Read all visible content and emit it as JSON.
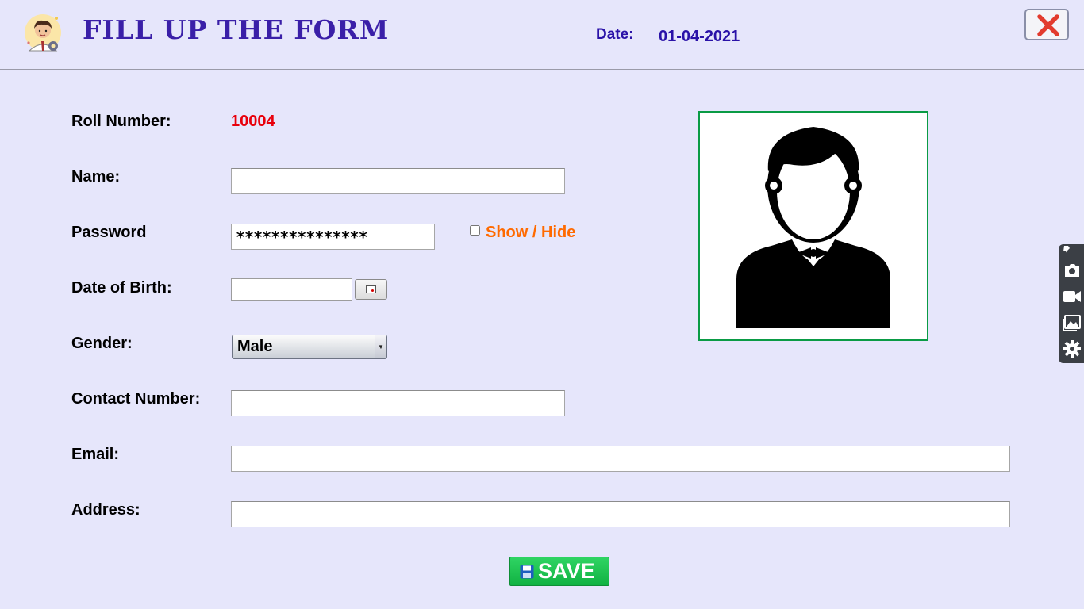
{
  "header": {
    "title": "FILL UP THE FORM",
    "date_label": "Date:",
    "date_value": "01-04-2021"
  },
  "form": {
    "roll_label": "Roll Number:",
    "roll_value": "10004",
    "name_label": "Name:",
    "name_value": "",
    "password_label": "Password",
    "password_value": "***************",
    "show_hide_label": "Show / Hide",
    "show_hide_checked": false,
    "dob_label": "Date of Birth:",
    "dob_value": "",
    "gender_label": "Gender:",
    "gender_value": "Male",
    "contact_label": "Contact Number:",
    "contact_value": "",
    "email_label": "Email:",
    "email_value": "",
    "address_label": "Address:",
    "address_value": ""
  },
  "actions": {
    "save_label": "SAVE"
  },
  "icons": {
    "logo": "user-settings-icon",
    "close": "close-icon",
    "calendar": "calendar-icon",
    "avatar": "user-avatar-icon",
    "save": "floppy-disk-icon",
    "toolbar": [
      "pin-icon",
      "camera-icon",
      "video-icon",
      "gallery-icon",
      "gear-icon"
    ]
  },
  "colors": {
    "background": "#e6e6fb",
    "title": "#3a1fa8",
    "roll_value": "#e8000b",
    "show_hide": "#ff6a00",
    "photo_border": "#0a9b45",
    "save_button": "#16bb4a",
    "close_x": "#e23b2e"
  }
}
